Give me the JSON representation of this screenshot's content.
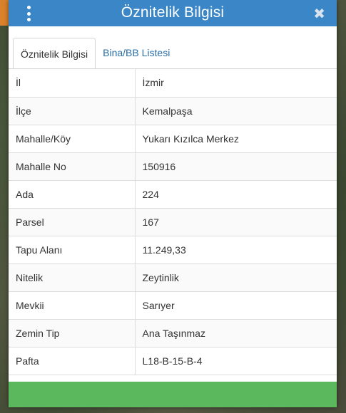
{
  "dialog": {
    "title": "Öznitelik Bilgisi",
    "close_symbol": "✖",
    "menu_icon": "vertical-dots-icon",
    "close_icon": "close-icon"
  },
  "tabs": [
    {
      "label": "Öznitelik Bilgisi",
      "active": true
    },
    {
      "label": "Bina/BB Listesi",
      "active": false
    }
  ],
  "attributes": [
    {
      "key": "İl",
      "value": "İzmir"
    },
    {
      "key": "İlçe",
      "value": "Kemalpaşa"
    },
    {
      "key": "Mahalle/Köy",
      "value": "Yukarı Kızılca Merkez"
    },
    {
      "key": "Mahalle No",
      "value": "150916"
    },
    {
      "key": "Ada",
      "value": "224"
    },
    {
      "key": "Parsel",
      "value": "167"
    },
    {
      "key": "Tapu Alanı",
      "value": "11.249,33"
    },
    {
      "key": "Nitelik",
      "value": "Zeytinlik"
    },
    {
      "key": "Mevkii",
      "value": "Sarıyer"
    },
    {
      "key": "Zemin Tip",
      "value": "Ana Taşınmaz"
    },
    {
      "key": "Pafta",
      "value": "L18-B-15-B-4"
    }
  ],
  "colors": {
    "header": "#3b86c7",
    "footer": "#5cb85c",
    "tab_link": "#2a6fa8"
  }
}
